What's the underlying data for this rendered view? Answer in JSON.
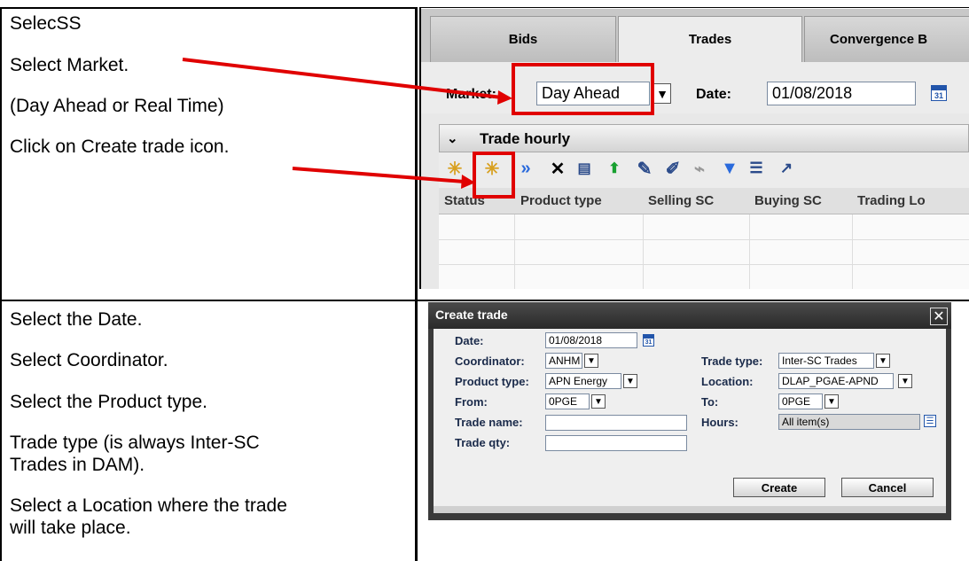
{
  "steps_top": [
    "SelecSS",
    "Select Market.",
    "(Day Ahead or Real Time)",
    "Click on Create trade icon."
  ],
  "steps_bottom": [
    "Select the Date.",
    "Select Coordinator.",
    "Select the Product type.",
    "Trade type (is always Inter-SC",
    "Trades in DAM).",
    "Select a Location where the trade",
    "will take place."
  ],
  "trades_screen": {
    "tabs": [
      "Bids",
      "Trades",
      "Convergence B"
    ],
    "active_tab": "Trades",
    "market_label": "Market:",
    "market_value": "Day Ahead",
    "date_label": "Date:",
    "date_value": "01/08/2018",
    "calendar_day": "31",
    "section_title": "Trade hourly",
    "toolbar_icons": [
      "copy-icon",
      "create-trade-icon",
      "submit-icon",
      "delete-icon",
      "view-icon",
      "upload-icon",
      "edit-icon",
      "clear-icon",
      "sweep-icon",
      "filter-icon",
      "list-icon",
      "export-icon"
    ],
    "columns": [
      "Status",
      "Product type",
      "Selling SC",
      "Buying SC",
      "Trading Lo"
    ]
  },
  "create_trade_dialog": {
    "title": "Create trade",
    "close_glyph": "✕",
    "date_label": "Date:",
    "date_value": "01/08/2018",
    "calendar_day": "31",
    "coordinator_label": "Coordinator:",
    "coordinator_value": "ANHM",
    "trade_type_label": "Trade type:",
    "trade_type_value": "Inter-SC Trades",
    "product_type_label": "Product type:",
    "product_type_value": "APN Energy",
    "location_label": "Location:",
    "location_value": "DLAP_PGAE-APND",
    "from_label": "From:",
    "from_value": "0PGE",
    "to_label": "To:",
    "to_value": "0PGE",
    "trade_name_label": "Trade name:",
    "trade_name_value": "",
    "hours_label": "Hours:",
    "hours_value": "All item(s)",
    "trade_qty_label": "Trade qty:",
    "trade_qty_value": "",
    "create_button": "Create",
    "cancel_button": "Cancel"
  },
  "colors": {
    "annotation_red": "#e00000",
    "dialog_frame": "#3a3a3a",
    "label_navy": "#1a2a4a"
  }
}
